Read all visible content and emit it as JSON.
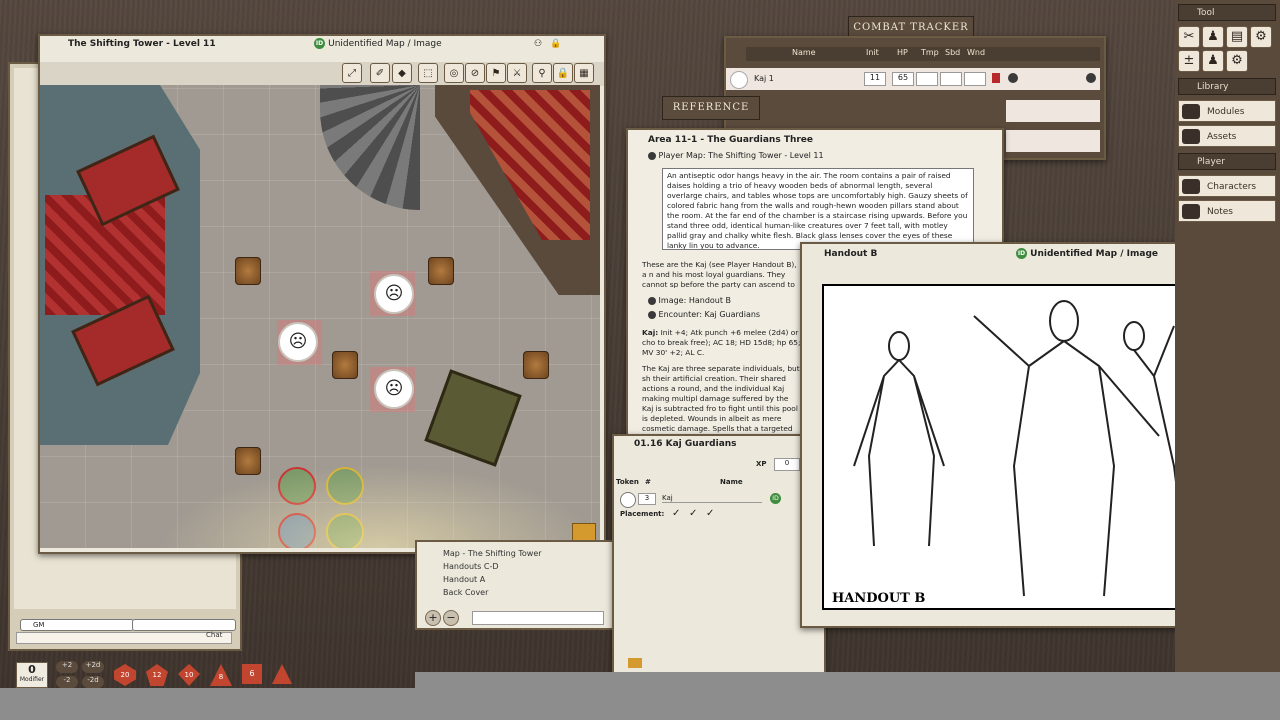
{
  "map_window": {
    "title": "The Shifting Tower - Level 11",
    "status": "Unidentified Map / Image",
    "id_badge": "ID"
  },
  "combat_tracker": {
    "header": "COMBAT TRACKER",
    "columns": [
      "Name",
      "Init",
      "HP",
      "Tmp",
      "Sbd",
      "Wnd"
    ],
    "rows": [
      {
        "name": "Kaj 1",
        "init": "11",
        "hp": "65",
        "tmp": "",
        "sbd": "",
        "wnd": ""
      }
    ]
  },
  "reference": {
    "header": "REFERENCE",
    "title": "Area 11-1 - The Guardians Three",
    "map_link": "Player Map: The Shifting Tower - Level 11",
    "boxed_text": "An antiseptic odor hangs heavy in the air. The room contains a pair of raised daises holding a trio of heavy wooden beds of abnormal length, several overlarge chairs, and tables whose tops are uncomfortably high. Gauzy sheets of colored fabric hang from the walls and rough-hewn wooden pillars stand about the room. At the far end of the chamber is a staircase rising upwards. Before you stand three odd, identical human-like creatures over 7 feet tall, with motley pallid gray and chalky white flesh. Black glass lenses cover the eyes of these lanky lin you to advance.",
    "para1": "These are the Kaj (see Player Handout B), a n and his most loyal guardians. They cannot sp before the party can ascend to the wizard's le",
    "link_image": "Image: Handout B",
    "link_encounter": "Encounter: Kaj Guardians",
    "stat_label": "Kaj:",
    "stat_text": "Init +4; Atk punch +6 melee (2d4) or cho to break free); AC 18; HD 15d8; hp 65; MV 30' +2; AL C.",
    "para2": "The Kaj are three separate individuals, but sh their artificial creation. Their shared actions a round, and the individual Kaj making multipl damage suffered by the Kaj is subtracted fro to fight until this pool is depleted. Wounds in albeit as mere cosmetic damage. Spells that a targeted Kaj. The Kaj have abnormally long a",
    "list_items": [
      "Map - The Shifting Tower",
      "Handouts C-D",
      "Handout A",
      "Back Cover"
    ]
  },
  "encounter": {
    "title": "01.16 Kaj Guardians",
    "xp_label": "XP",
    "xp_value": "0",
    "col_token": "Token",
    "col_num": "#",
    "col_name": "Name",
    "row_count": "3",
    "row_name": "Kaj",
    "placement_label": "Placement:"
  },
  "handout_window": {
    "title": "Handout B",
    "status": "Unidentified Map / Image",
    "caption": "HANDOUT B"
  },
  "chat": {
    "identity": "GM",
    "mood": "",
    "chat_button": "Chat"
  },
  "dice_bar": {
    "modifier_value": "0",
    "modifier_label": "Modifier",
    "mod_buttons": [
      "+2",
      "+2d",
      "-2",
      "-2d"
    ],
    "dice": [
      "20",
      "12",
      "10",
      "8",
      "6",
      "4"
    ]
  },
  "sidebar": {
    "tool_header": "Tool",
    "library_header": "Library",
    "library_items": [
      "Modules",
      "Assets"
    ],
    "player_header": "Player",
    "player_items": [
      "Characters",
      "Notes"
    ]
  },
  "colors": {
    "desk": "#4a3f37",
    "panel": "#ece8dc",
    "frame": "#6b5a44",
    "accent_red": "#b8272a",
    "id_green": "#3f8d3f"
  }
}
